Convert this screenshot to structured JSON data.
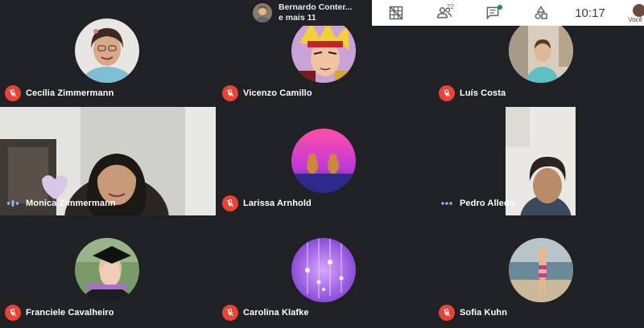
{
  "presenter": {
    "name": "Bernardo Conter...",
    "others": "e mais 11"
  },
  "toolbar": {
    "participants_count": "22",
    "clock": "10:17",
    "self_label": "Você"
  },
  "participants": [
    {
      "name": "Cecília Zimmermann",
      "state": "muted"
    },
    {
      "name": "Vicenzo Camillo",
      "state": "muted"
    },
    {
      "name": "Luís Costa",
      "state": "muted"
    },
    {
      "name": "Monica Zimmermann",
      "state": "speaking"
    },
    {
      "name": "Larissa Arnhold",
      "state": "muted"
    },
    {
      "name": "Pedro Alledo",
      "state": "more"
    },
    {
      "name": "Franciele Cavalheiro",
      "state": "muted"
    },
    {
      "name": "Carolina Klafke",
      "state": "muted"
    },
    {
      "name": "Sofia Kuhn",
      "state": "muted"
    }
  ],
  "colors": {
    "background": "#202124",
    "muted_red": "#ea4335",
    "speaking_teal": "#8ab4f8",
    "toolbar_white": "#ffffff"
  },
  "icons": [
    "mic-off-icon",
    "speaking-icon",
    "more-dots-icon",
    "grid-off-icon",
    "people-icon",
    "chat-icon",
    "activities-icon"
  ]
}
